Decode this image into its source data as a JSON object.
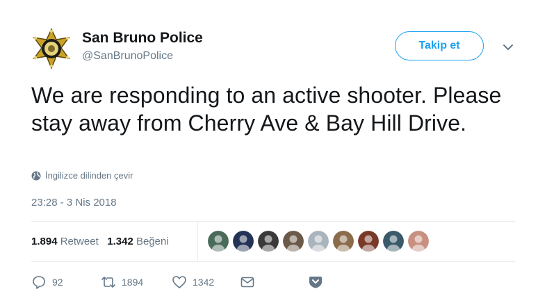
{
  "user": {
    "name": "San Bruno Police",
    "handle": "@SanBrunoPolice",
    "follow_label": "Takip et"
  },
  "tweet": {
    "text": "We are responding to an active shooter. Please stay away from Cherry Ave & Bay Hill Drive.",
    "translate_label": "İngilizce dilinden çevir",
    "timestamp": "23:28 - 3 Nis 2018"
  },
  "stats": {
    "retweets_count": "1.894",
    "retweets_label": "Retweet",
    "likes_count": "1.342",
    "likes_label": "Beğeni"
  },
  "likers": [
    "#4a6a5a",
    "#223355",
    "#3a3a3a",
    "#6b5a4a",
    "#aab4bc",
    "#8a6b4a",
    "#7a3a2a",
    "#3a5a6a",
    "#c89080"
  ],
  "actions": {
    "reply_count": "92",
    "retweet_count": "1894",
    "like_count": "1342"
  },
  "colors": {
    "accent": "#1da1f2",
    "muted": "#657786",
    "text": "#14171a",
    "badge_gold": "#c9a227"
  }
}
